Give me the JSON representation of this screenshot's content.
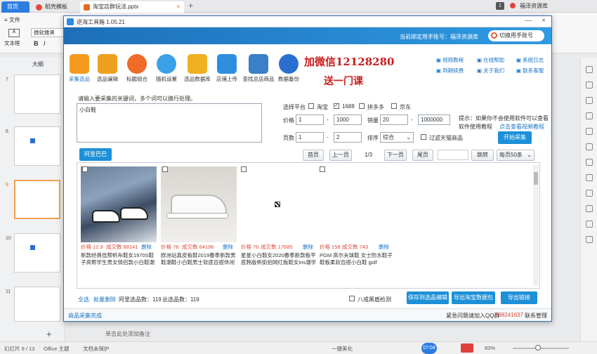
{
  "os": {
    "tabs": [
      {
        "label": "首页"
      },
      {
        "label": "稻壳模板"
      },
      {
        "label": "淘宝店群玩法.pptx"
      }
    ],
    "right_user": "福泽资源库",
    "file_menu": "文件",
    "font_name": "微软雅黑",
    "textbox_label": "文本框"
  },
  "left": {
    "outline_tab": "大纲",
    "slides": [
      {
        "num": "7"
      },
      {
        "num": "8"
      },
      {
        "num": "9"
      },
      {
        "num": "10"
      },
      {
        "num": "11"
      }
    ]
  },
  "status": {
    "slide_pos": "幻灯片 9 / 13",
    "theme": "Office 主题",
    "protect": "文档未保护",
    "beautify": "一键美化",
    "zoom": "83%",
    "note": "单击此处添加备注",
    "time": "07:04"
  },
  "app": {
    "title": "逆海工具箱 1.05.21",
    "bind_text": "当前绑定用手账号：福泽资源库",
    "switch_btn": "切换用手账号",
    "tools": [
      {
        "label": "采集选品",
        "color": "#f39a1f"
      },
      {
        "label": "选品编辑",
        "color": "#f0a020"
      },
      {
        "label": "标题组合",
        "color": "#f06a2a"
      },
      {
        "label": "随机设置",
        "color": "#3aa0e8"
      },
      {
        "label": "选品数据库",
        "color": "#f0b020"
      },
      {
        "label": "店铺上传",
        "color": "#2e8fe0"
      },
      {
        "label": "查找总店商品",
        "color": "#3a7fc8"
      },
      {
        "label": "数据备份",
        "color": "#2a6fd0"
      }
    ],
    "watermark1": "加微信12128280",
    "watermark2": "送一门课",
    "links": [
      "视频教程",
      "在线帮助",
      "系统日志",
      "到期续费",
      "关于我们",
      "联系客服"
    ],
    "kw_prompt": "请输入要采集的关键词，多个词可以换行处理。",
    "kw_value": "小白鞋",
    "platform_label": "选择平台",
    "platforms": [
      {
        "label": "淘宝",
        "checked": false
      },
      {
        "label": "1688",
        "checked": true
      },
      {
        "label": "拼多多",
        "checked": false
      },
      {
        "label": "京东",
        "checked": false
      }
    ],
    "price_label": "价格",
    "price_min": "1",
    "price_max": "1000",
    "sales_label": "销量",
    "sales_min": "20",
    "sales_max": "1000000",
    "page_label": "页数",
    "page_min": "1",
    "page_max": "2",
    "sort_label": "排序",
    "sort_value": "综合",
    "filter_tmall": "过滤天猫商品",
    "tip1": "提示：如果你不会使用软件可以查看",
    "tip2": "软件使用教程",
    "tip_link": "点击查看视频教程",
    "start_btn": "开始采集",
    "source_tab": "阿里巴巴",
    "pager": {
      "first": "首页",
      "prev": "上一页",
      "pages": "1/3",
      "next": "下一页",
      "last": "尾页",
      "jump": "跳转",
      "per_page": "每页50条"
    },
    "products": [
      {
        "price": "价格 12.9",
        "deals": "成交数 88141",
        "del": "删除",
        "title1": "新款经典低帮帆布鞋女1970S鞋",
        "title2": "子高帮学生男女情侣款小白鞋潮"
      },
      {
        "price": "价格 78",
        "deals": "成交数 64196",
        "del": "删除",
        "title1": "欧洲站真皮板鞋2019春季新款男",
        "title2": "鞋潮鞋小白鞋男士软底百搭休闲"
      },
      {
        "price": "价格 76",
        "deals": "成交数 17685",
        "del": "删除",
        "title1": "星星小白鞋女2020春季新款板平",
        "title2": "底韩版帆街拍网红板鞋女ins潮学"
      },
      {
        "price": "价格 158",
        "deals": "成交数 743",
        "del": "删除",
        "title1": "PGM 高尔夫球鞋 女士防水鞋子",
        "title2": "鞋板柔软百搭小白鞋 golf"
      }
    ],
    "bottom": {
      "select_all": "全选",
      "batch_del": "批量删除",
      "ali_count": "阿里选品数：119",
      "total_count": "总选品数：119",
      "anti_label": "八戒黑盾检测",
      "save_btn": "保存到选品编辑",
      "export_taobao": "导出淘宝数据包",
      "export_link": "导出链接"
    },
    "status_done": "商品采集完成",
    "qq_text": "紧急问题请加入QQ群",
    "qq_num": "798241637",
    "contact": "联系管理"
  }
}
